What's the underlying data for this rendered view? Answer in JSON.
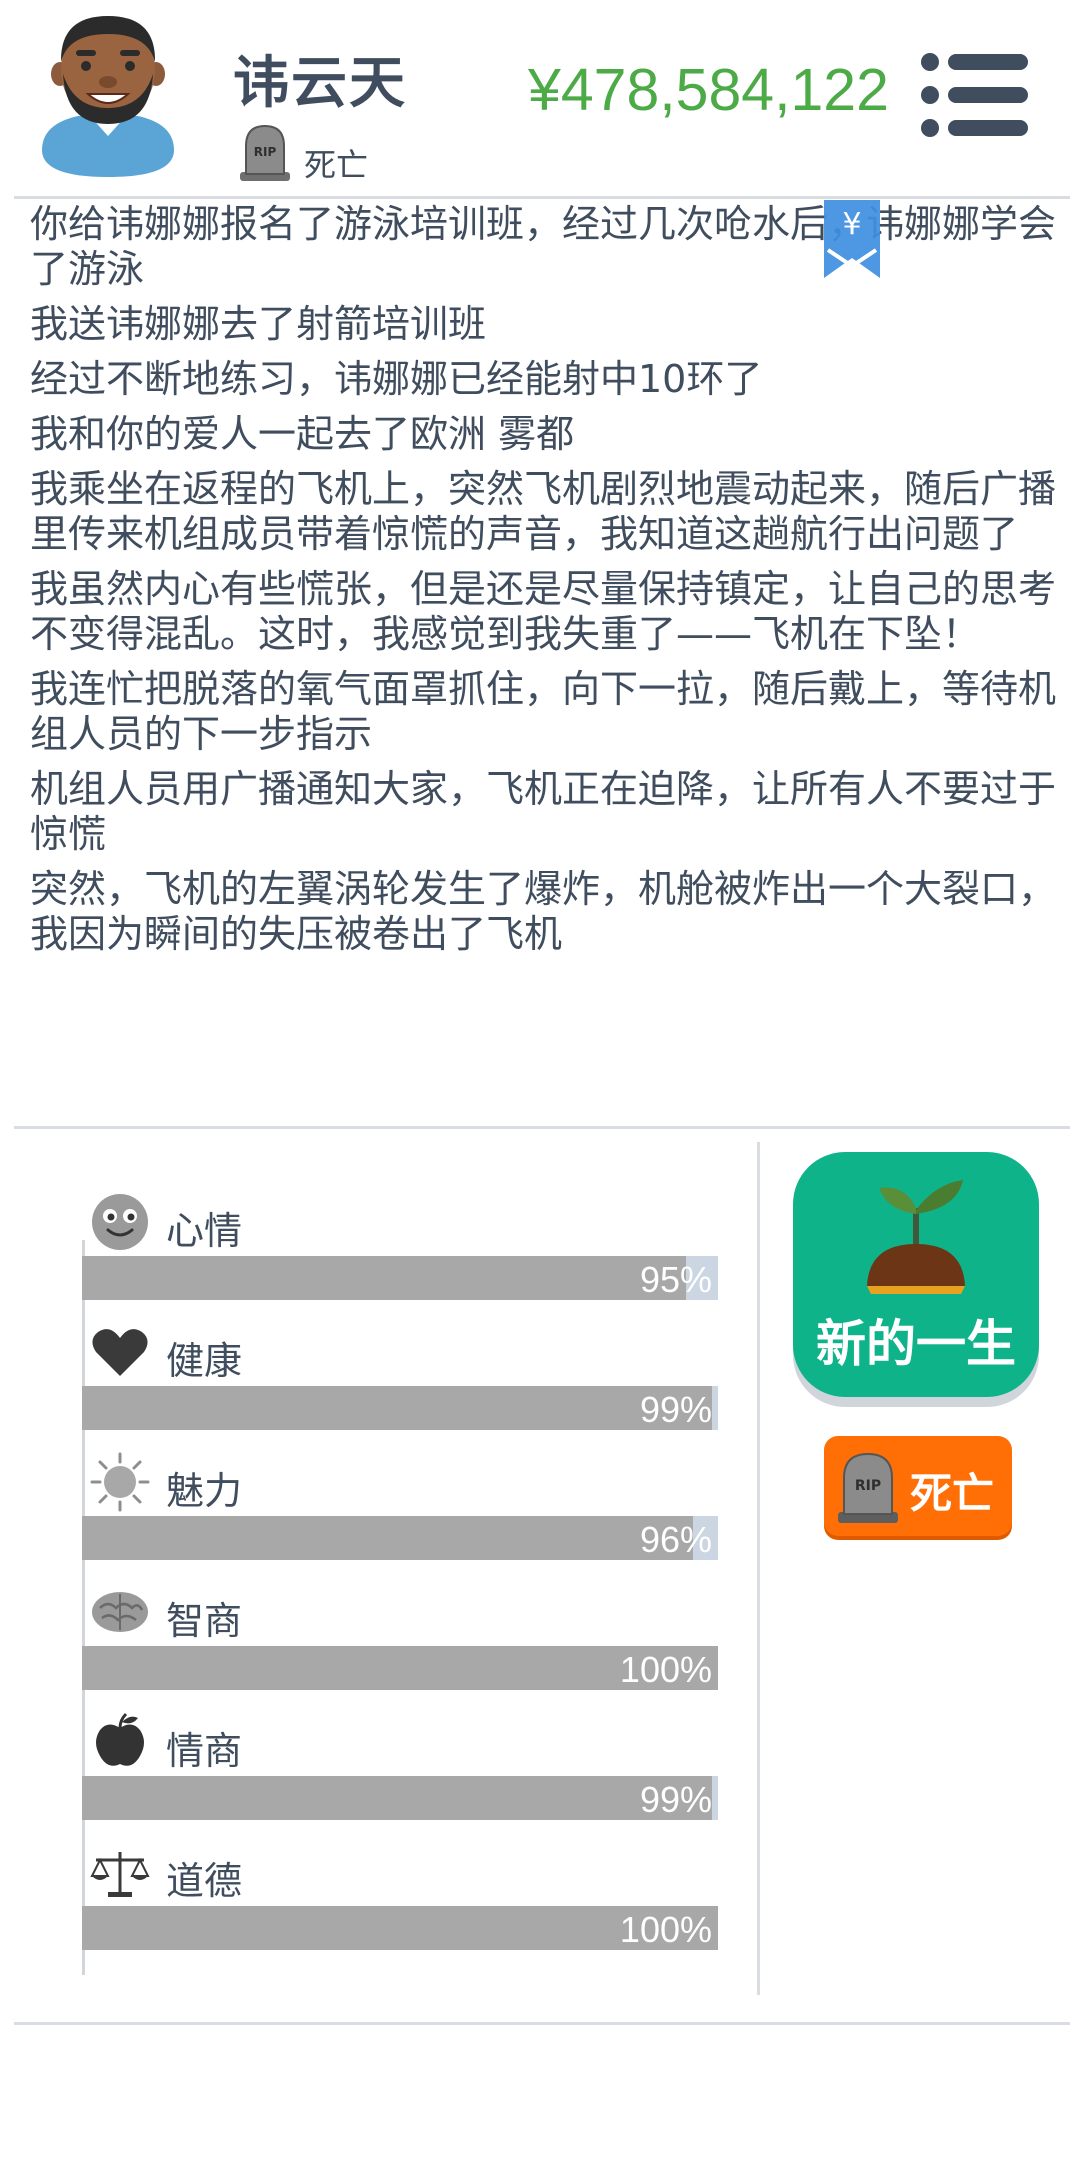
{
  "player": {
    "name": "讳云天",
    "status": "死亡",
    "money": "¥478,584,122"
  },
  "log": [
    "你给讳娜娜报名了游泳培训班，经过几次呛水后，讳娜娜学会了游泳",
    "我送讳娜娜去了射箭培训班",
    "经过不断地练习，讳娜娜已经能射中10环了",
    "我和你的爱人一起去了欧洲 雾都",
    "我乘坐在返程的飞机上，突然飞机剧烈地震动起来，随后广播里传来机组成员带着惊慌的声音，我知道这趟航行出问题了",
    "我虽然内心有些慌张，但是还是尽量保持镇定，让自己的思考不变得混乱。这时，我感觉到我失重了——飞机在下坠！",
    "我连忙把脱落的氧气面罩抓住，向下一拉，随后戴上，等待机组人员的下一步指示",
    "机组人员用广播通知大家，飞机正在迫降，让所有人不要过于惊慌",
    "突然，飞机的左翼涡轮发生了爆炸，机舱被炸出一个大裂口，我因为瞬间的失压被卷出了飞机"
  ],
  "bookmark_symbol": "¥",
  "stats": [
    {
      "icon": "smiley-face-icon",
      "label": "心情",
      "value": 95,
      "display": "95%"
    },
    {
      "icon": "heart-icon",
      "label": "健康",
      "value": 99,
      "display": "99%"
    },
    {
      "icon": "sun-icon",
      "label": "魅力",
      "value": 96,
      "display": "96%"
    },
    {
      "icon": "brain-icon",
      "label": "智商",
      "value": 100,
      "display": "100%"
    },
    {
      "icon": "apple-icon",
      "label": "情商",
      "value": 99,
      "display": "99%"
    },
    {
      "icon": "balance-scale-icon",
      "label": "道德",
      "value": 100,
      "display": "100%"
    }
  ],
  "buttons": {
    "new_life": "新的一生",
    "death": "死亡"
  },
  "tombstone_text": "RIP",
  "colors": {
    "money": "#4caa47",
    "primary_text": "#3f4d5e",
    "new_life_button": "#0fb389",
    "death_button": "#ff6f06",
    "bar_fill": "#a8a8a8",
    "bar_track": "#ccd6e2"
  }
}
